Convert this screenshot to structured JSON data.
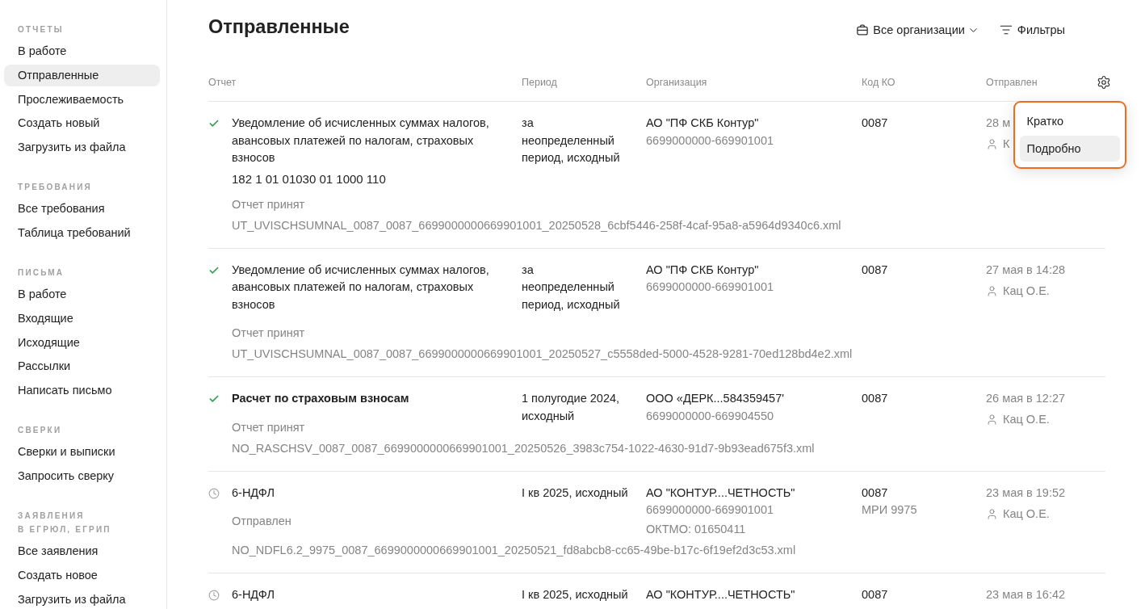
{
  "sidebar": {
    "sections": [
      {
        "title": "ОТЧЕТЫ",
        "items": [
          {
            "label": "В работе",
            "selected": false
          },
          {
            "label": "Отправленные",
            "selected": true
          },
          {
            "label": "Прослеживаемость",
            "selected": false
          },
          {
            "label": "Создать новый",
            "selected": false
          },
          {
            "label": "Загрузить из файла",
            "selected": false
          }
        ]
      },
      {
        "title": "ТРЕБОВАНИЯ",
        "items": [
          {
            "label": "Все требования",
            "selected": false
          },
          {
            "label": "Таблица требований",
            "selected": false
          }
        ]
      },
      {
        "title": "ПИСЬМА",
        "items": [
          {
            "label": "В работе",
            "selected": false
          },
          {
            "label": "Входящие",
            "selected": false
          },
          {
            "label": "Исходящие",
            "selected": false
          },
          {
            "label": "Рассылки",
            "selected": false
          },
          {
            "label": "Написать письмо",
            "selected": false
          }
        ]
      },
      {
        "title": "СВЕРКИ",
        "items": [
          {
            "label": "Сверки и выписки",
            "selected": false
          },
          {
            "label": "Запросить сверку",
            "selected": false
          }
        ]
      },
      {
        "title": "ЗАЯВЛЕНИЯ\nВ ЕГРЮЛ, ЕГРИП",
        "items": [
          {
            "label": "Все заявления",
            "selected": false
          },
          {
            "label": "Создать новое",
            "selected": false
          },
          {
            "label": "Загрузить из файла",
            "selected": false
          }
        ]
      }
    ]
  },
  "page": {
    "title": "Отправленные",
    "organizations_filter": "Все организации",
    "filters_button": "Фильтры"
  },
  "table": {
    "columns": [
      "Отчет",
      "Период",
      "Организация",
      "Код КО",
      "Отправлен"
    ],
    "rows": [
      {
        "kind": "accepted",
        "title": "Уведомление об исчисленных суммах налогов, авансовых платежей по налогам, страховых взносов",
        "emphasized": false,
        "kbk": "182 1 01 01030 01 1000 110",
        "status": "Отчет принят",
        "file": "UT_UVISCHSUMNAL_0087_0087_6699000000669901001_20250528_6cbf5446-258f-4caf-95a8-a5964d9340c6.xml",
        "period": "за неопределенный период, исходный",
        "organization": {
          "name": "АО \"ПФ СКБ Контур\"",
          "inn": "6699000000-669901001"
        },
        "code": {
          "number": "0087"
        },
        "sent": {
          "date": "28 м",
          "user": "К"
        }
      },
      {
        "kind": "accepted",
        "title": "Уведомление об исчисленных суммах налогов, авансовых платежей по налогам, страховых взносов",
        "emphasized": false,
        "status": "Отчет принят",
        "file": "UT_UVISCHSUMNAL_0087_0087_6699000000669901001_20250527_c5558ded-5000-4528-9281-70ed128bd4e2.xml",
        "period": "за неопределенный период, исходный",
        "organization": {
          "name": "АО \"ПФ СКБ Контур\"",
          "inn": "6699000000-669901001"
        },
        "code": {
          "number": "0087"
        },
        "sent": {
          "date": "27 мая в 14:28",
          "user": "Кац О.Е."
        }
      },
      {
        "kind": "accepted",
        "title": "Расчет по страховым взносам",
        "emphasized": true,
        "status": "Отчет принят",
        "file": "NO_RASCHSV_0087_0087_6699000000669901001_20250526_3983c754-1022-4630-91d7-9b93ead675f3.xml",
        "period": "1 полугодие 2024, исходный",
        "organization": {
          "name": "ООО «ДЕРК...584359457'",
          "inn": "6699000000-669904550"
        },
        "code": {
          "number": "0087"
        },
        "sent": {
          "date": "26 мая в 12:27",
          "user": "Кац О.Е."
        }
      },
      {
        "kind": "sent",
        "title": "6-НДФЛ",
        "emphasized": false,
        "status": "Отправлен",
        "file": "NO_NDFL6.2_9975_0087_6699000000669901001_20250521_fd8abcb8-cc65-49be-b17c-6f19ef2d3c53.xml",
        "period": "I кв 2025, исходный",
        "organization": {
          "name": "АО \"КОНТУР....ЧЕТНОСТЬ\"",
          "inn": "6699000000-669901001",
          "oktmo": "ОКТМО: 01650411"
        },
        "code": {
          "number": "0087",
          "inspection": "МРИ 9975"
        },
        "sent": {
          "date": "23 мая в 19:52",
          "user": "Кац О.Е."
        }
      },
      {
        "kind": "sent",
        "title": "6-НДФЛ",
        "emphasized": false,
        "period": "I кв 2025, исходный",
        "organization": {
          "name": "АО \"КОНТУР....ЧЕТНОСТЬ\""
        },
        "code": {
          "number": "0087"
        },
        "sent": {
          "date": "23 мая в 16:42"
        }
      }
    ]
  },
  "view_menu": {
    "items": [
      {
        "label": "Кратко",
        "selected": false
      },
      {
        "label": "Подробно",
        "selected": true
      }
    ]
  }
}
